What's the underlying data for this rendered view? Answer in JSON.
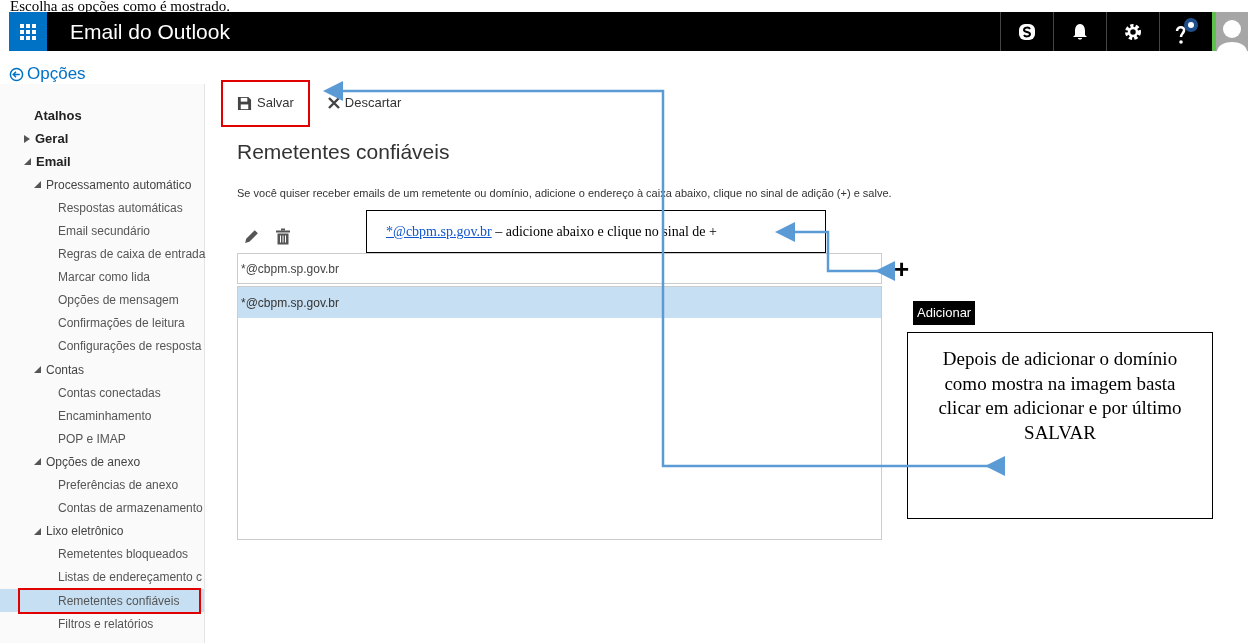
{
  "doc_caption": "Escolha as opções como é mostrado.",
  "top_bar": {
    "title": "Email do Outlook"
  },
  "back_link": "Opções",
  "sidebar": {
    "items": [
      {
        "label": "Atalhos",
        "kind": "header",
        "selected": false,
        "marked": false
      },
      {
        "label": "Geral",
        "kind": "branch",
        "expanded": false,
        "selected": false,
        "marked": false
      },
      {
        "label": "Email",
        "kind": "branch",
        "expanded": true,
        "selected": false,
        "marked": false,
        "children": [
          {
            "label": "Processamento automático",
            "kind": "group",
            "expanded": true,
            "selected": false,
            "marked": false,
            "children": [
              {
                "label": "Respostas automáticas",
                "kind": "leaf",
                "selected": false,
                "marked": false
              },
              {
                "label": "Email secundário",
                "kind": "leaf",
                "selected": false,
                "marked": false
              },
              {
                "label": "Regras de caixa de entrada",
                "kind": "leaf",
                "selected": false,
                "marked": false
              },
              {
                "label": "Marcar como lida",
                "kind": "leaf",
                "selected": false,
                "marked": false
              },
              {
                "label": "Opções de mensagem",
                "kind": "leaf",
                "selected": false,
                "marked": false
              },
              {
                "label": "Confirmações de leitura",
                "kind": "leaf",
                "selected": false,
                "marked": false
              },
              {
                "label": "Configurações de resposta",
                "kind": "leaf",
                "selected": false,
                "marked": false
              }
            ]
          },
          {
            "label": "Contas",
            "kind": "group",
            "expanded": true,
            "selected": false,
            "marked": false,
            "children": [
              {
                "label": "Contas conectadas",
                "kind": "leaf",
                "selected": false,
                "marked": false
              },
              {
                "label": "Encaminhamento",
                "kind": "leaf",
                "selected": false,
                "marked": false
              },
              {
                "label": "POP e IMAP",
                "kind": "leaf",
                "selected": false,
                "marked": false
              }
            ]
          },
          {
            "label": "Opções de anexo",
            "kind": "group",
            "expanded": true,
            "selected": false,
            "marked": false,
            "children": [
              {
                "label": "Preferências de anexo",
                "kind": "leaf",
                "selected": false,
                "marked": false
              },
              {
                "label": "Contas de armazenamento",
                "kind": "leaf",
                "selected": false,
                "marked": false
              }
            ]
          },
          {
            "label": "Lixo eletrônico",
            "kind": "group",
            "expanded": true,
            "selected": false,
            "marked": false,
            "children": [
              {
                "label": "Remetentes bloqueados",
                "kind": "leaf",
                "selected": false,
                "marked": false
              },
              {
                "label": "Listas de endereçamento c",
                "kind": "leaf",
                "selected": false,
                "marked": false
              },
              {
                "label": "Remetentes confiáveis",
                "kind": "leaf",
                "selected": true,
                "marked": true
              },
              {
                "label": "Filtros e relatórios",
                "kind": "leaf",
                "selected": false,
                "marked": false
              }
            ]
          }
        ]
      }
    ]
  },
  "toolbar": [
    {
      "label": "Salvar",
      "kind": "save",
      "marked": true
    },
    {
      "label": "Descartar",
      "kind": "discard",
      "marked": false
    }
  ],
  "heading": "Remetentes confiáveis",
  "description": "Se você quiser receber emails de um remetente ou domínio, adicione o endereço à caixa abaixo, clique no sinal de adição (+) e salve.",
  "input": {
    "value": "*@cbpm.sp.gov.br"
  },
  "add_button": "+",
  "tooltip": "Adicionar",
  "senders": [
    {
      "label": "*@cbpm.sp.gov.br",
      "selected": true
    }
  ],
  "callout": {
    "link": "*@cbpm.sp.gov.br",
    "text": "– adicione abaixo e clique no sinal de +"
  },
  "note": "Depois de adicionar o domínio como mostra na imagem basta clicar em adicionar e por último SALVAR"
}
